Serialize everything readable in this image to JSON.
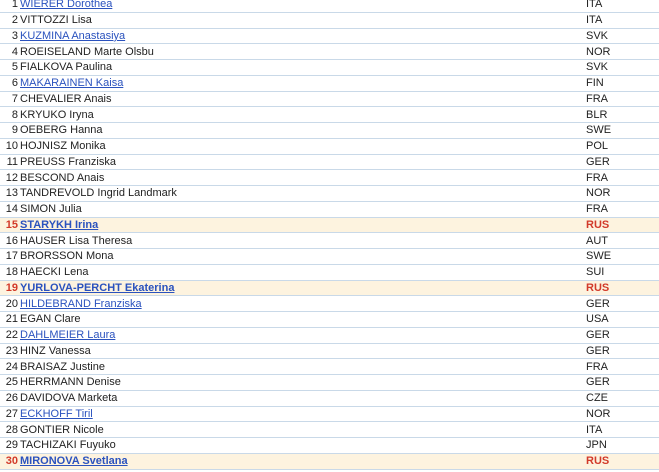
{
  "results": [
    {
      "rank": "1",
      "name": "WIERER Dorothea",
      "nation": "ITA",
      "link": true,
      "highlight": false
    },
    {
      "rank": "2",
      "name": "VITTOZZI Lisa",
      "nation": "ITA",
      "link": false,
      "highlight": false
    },
    {
      "rank": "3",
      "name": "KUZMINA Anastasiya",
      "nation": "SVK",
      "link": true,
      "highlight": false
    },
    {
      "rank": "4",
      "name": "ROEISELAND Marte Olsbu",
      "nation": "NOR",
      "link": false,
      "highlight": false
    },
    {
      "rank": "5",
      "name": "FIALKOVA Paulina",
      "nation": "SVK",
      "link": false,
      "highlight": false
    },
    {
      "rank": "6",
      "name": "MAKARAINEN Kaisa",
      "nation": "FIN",
      "link": true,
      "highlight": false
    },
    {
      "rank": "7",
      "name": "CHEVALIER Anais",
      "nation": "FRA",
      "link": false,
      "highlight": false
    },
    {
      "rank": "8",
      "name": "KRYUKO Iryna",
      "nation": "BLR",
      "link": false,
      "highlight": false
    },
    {
      "rank": "9",
      "name": "OEBERG Hanna",
      "nation": "SWE",
      "link": false,
      "highlight": false
    },
    {
      "rank": "10",
      "name": "HOJNISZ Monika",
      "nation": "POL",
      "link": false,
      "highlight": false
    },
    {
      "rank": "11",
      "name": "PREUSS Franziska",
      "nation": "GER",
      "link": false,
      "highlight": false
    },
    {
      "rank": "12",
      "name": "BESCOND Anais",
      "nation": "FRA",
      "link": false,
      "highlight": false
    },
    {
      "rank": "13",
      "name": "TANDREVOLD Ingrid Landmark",
      "nation": "NOR",
      "link": false,
      "highlight": false
    },
    {
      "rank": "14",
      "name": "SIMON Julia",
      "nation": "FRA",
      "link": false,
      "highlight": false
    },
    {
      "rank": "15",
      "name": "STARYKH Irina",
      "nation": "RUS",
      "link": true,
      "highlight": true
    },
    {
      "rank": "16",
      "name": "HAUSER Lisa Theresa",
      "nation": "AUT",
      "link": false,
      "highlight": false
    },
    {
      "rank": "17",
      "name": "BRORSSON Mona",
      "nation": "SWE",
      "link": false,
      "highlight": false
    },
    {
      "rank": "18",
      "name": "HAECKI Lena",
      "nation": "SUI",
      "link": false,
      "highlight": false
    },
    {
      "rank": "19",
      "name": "YURLOVA-PERCHT Ekaterina",
      "nation": "RUS",
      "link": true,
      "highlight": true
    },
    {
      "rank": "20",
      "name": "HILDEBRAND Franziska",
      "nation": "GER",
      "link": true,
      "highlight": false
    },
    {
      "rank": "21",
      "name": "EGAN Clare",
      "nation": "USA",
      "link": false,
      "highlight": false
    },
    {
      "rank": "22",
      "name": "DAHLMEIER Laura",
      "nation": "GER",
      "link": true,
      "highlight": false
    },
    {
      "rank": "23",
      "name": "HINZ Vanessa",
      "nation": "GER",
      "link": false,
      "highlight": false
    },
    {
      "rank": "24",
      "name": "BRAISAZ Justine",
      "nation": "FRA",
      "link": false,
      "highlight": false
    },
    {
      "rank": "25",
      "name": "HERRMANN Denise",
      "nation": "GER",
      "link": false,
      "highlight": false
    },
    {
      "rank": "26",
      "name": "DAVIDOVA Marketa",
      "nation": "CZE",
      "link": false,
      "highlight": false
    },
    {
      "rank": "27",
      "name": "ECKHOFF Tiril",
      "nation": "NOR",
      "link": true,
      "highlight": false
    },
    {
      "rank": "28",
      "name": "GONTIER Nicole",
      "nation": "ITA",
      "link": false,
      "highlight": false
    },
    {
      "rank": "29",
      "name": "TACHIZAKI Fuyuko",
      "nation": "JPN",
      "link": false,
      "highlight": false
    },
    {
      "rank": "30",
      "name": "MIRONOVA Svetlana",
      "nation": "RUS",
      "link": true,
      "highlight": true
    }
  ],
  "colors": {
    "link": "#2a52be",
    "highlight_bg": "#fdf3df",
    "highlight_text": "#d23a2a",
    "row_border": "#c9d9e8"
  }
}
